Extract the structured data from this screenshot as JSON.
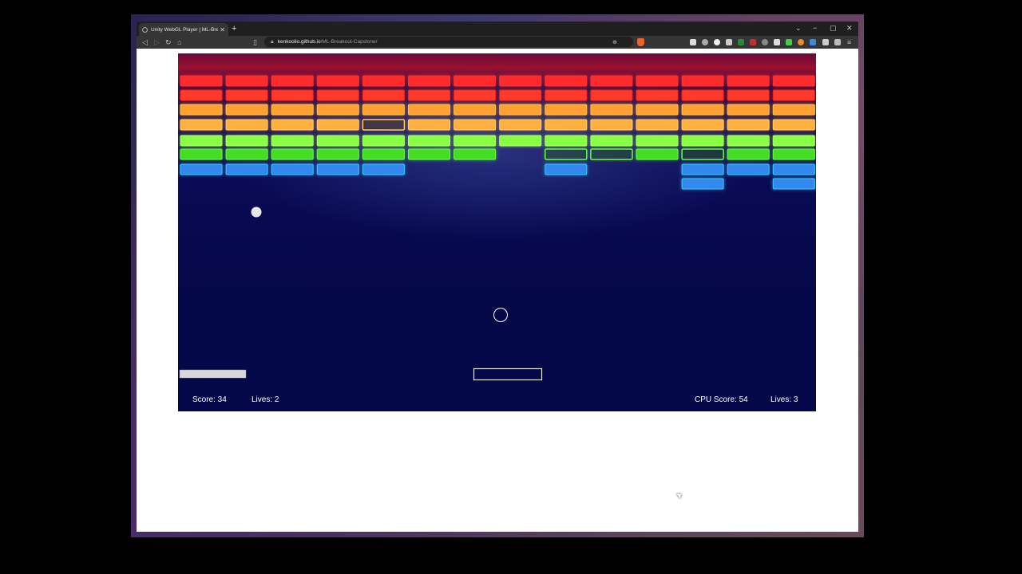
{
  "browser": {
    "tab_title": "Unity WebGL Player | ML-Breako",
    "tab_close": "✕",
    "new_tab": "+",
    "url_host": "kenkoolio.github.io",
    "url_path": "/ML-Breakout-Capstone/",
    "minimize": "−",
    "maximize": "▢",
    "close": "✕",
    "chevron": "⌄",
    "icons": [
      "back-icon",
      "forward-icon",
      "reload-icon",
      "home-icon",
      "bookmark-icon",
      "lock-icon",
      "zoom-icon",
      "brave-shield-icon"
    ]
  },
  "game": {
    "hud": {
      "score": "Score: 34",
      "lives": "Lives: 2",
      "cpu_score": "CPU Score: 54",
      "cpu_lives": "Lives: 3"
    },
    "brick_columns": 14,
    "brick_rows": [
      {
        "color": "#ff2a2a",
        "glow": "#ff3030",
        "present": [
          1,
          1,
          1,
          1,
          1,
          1,
          1,
          1,
          1,
          1,
          1,
          1,
          1,
          1
        ]
      },
      {
        "color": "#ff3a2a",
        "glow": "#ff2020",
        "present": [
          1,
          1,
          1,
          1,
          1,
          1,
          1,
          1,
          1,
          1,
          1,
          1,
          1,
          1
        ]
      },
      {
        "color": "#ffa030",
        "glow": "#ffc040",
        "present": [
          1,
          1,
          1,
          1,
          1,
          1,
          1,
          1,
          1,
          1,
          1,
          1,
          1,
          1
        ]
      },
      {
        "color": "#ffb040",
        "glow": "#ffd060",
        "present": [
          1,
          1,
          1,
          1,
          2,
          1,
          1,
          1,
          1,
          1,
          1,
          1,
          1,
          1
        ]
      },
      {
        "color": "#88ff44",
        "glow": "#aaff66",
        "present": [
          1,
          1,
          1,
          1,
          1,
          1,
          1,
          1,
          1,
          1,
          1,
          1,
          1,
          1
        ]
      },
      {
        "color": "#44dd22",
        "glow": "#66ff44",
        "present": [
          1,
          1,
          1,
          1,
          1,
          1,
          1,
          0,
          2,
          2,
          1,
          2,
          1,
          1
        ]
      },
      {
        "color": "#3388ee",
        "glow": "#33ccff",
        "present": [
          1,
          1,
          1,
          1,
          1,
          0,
          0,
          0,
          1,
          0,
          0,
          1,
          1,
          1
        ]
      },
      {
        "color": "#3388ee",
        "glow": "#33ccff",
        "present": [
          0,
          0,
          0,
          0,
          0,
          0,
          0,
          0,
          0,
          0,
          0,
          1,
          0,
          1
        ]
      }
    ]
  }
}
